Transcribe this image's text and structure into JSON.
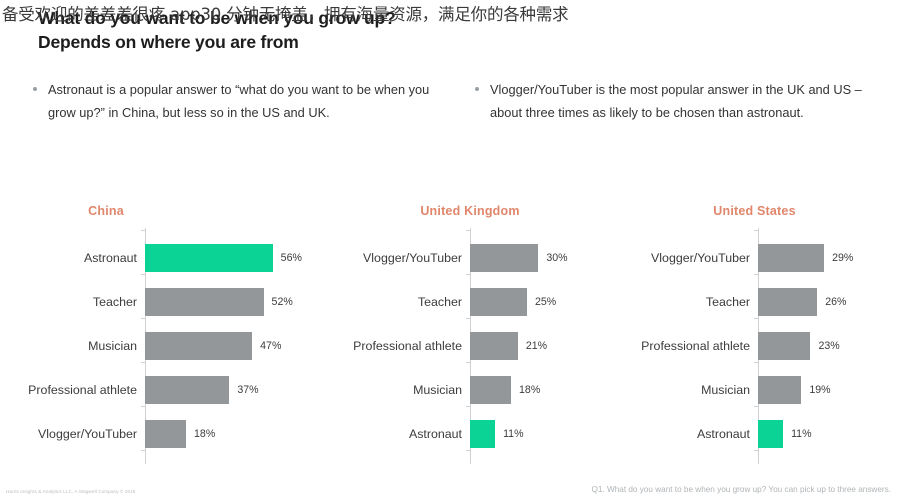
{
  "overlay": {
    "text": "备受欢迎的差差差很疼 app30 分钟无掩盖，拥有海量资源，满足你的各种需求"
  },
  "slide": {
    "title": "What do you want to be when you grow up? Depends on where you are from",
    "bullets": [
      "Astronaut is a popular answer to “what do you want to be when you grow up?” in China, but less so in the US and UK.",
      "Vlogger/YouTuber is the most popular answer in the UK and US – about three times as likely to be chosen than astronaut."
    ],
    "footer_left": "Harris Insights & Analytics LLC, A Stagwell Company © 2018",
    "footer_right": "Q1. What do you want to be when you grow up? You can pick up to three answers.",
    "colors": {
      "highlight": "#0bd395",
      "bar": "#949799",
      "panel_title": "#e0866b"
    }
  },
  "chart_data": [
    {
      "type": "bar",
      "title": "China",
      "orientation": "horizontal",
      "categories": [
        "Astronaut",
        "Teacher",
        "Musician",
        "Professional athlete",
        "Vlogger/YouTuber"
      ],
      "values": [
        56,
        52,
        47,
        37,
        18
      ],
      "labels": [
        "56%",
        "52%",
        "47%",
        "37%",
        "18%"
      ],
      "highlight_index": 0,
      "xlabel": "",
      "ylabel": "",
      "xlim": [
        0,
        60
      ],
      "grid": false,
      "legend": "none"
    },
    {
      "type": "bar",
      "title": "United Kingdom",
      "orientation": "horizontal",
      "categories": [
        "Vlogger/YouTuber",
        "Teacher",
        "Professional athlete",
        "Musician",
        "Astronaut"
      ],
      "values": [
        30,
        25,
        21,
        18,
        11
      ],
      "labels": [
        "30%",
        "25%",
        "21%",
        "18%",
        "11%"
      ],
      "highlight_index": 4,
      "xlabel": "",
      "ylabel": "",
      "xlim": [
        0,
        60
      ],
      "grid": false,
      "legend": "none"
    },
    {
      "type": "bar",
      "title": "United States",
      "orientation": "horizontal",
      "categories": [
        "Vlogger/YouTuber",
        "Teacher",
        "Professional athlete",
        "Musician",
        "Astronaut"
      ],
      "values": [
        29,
        26,
        23,
        19,
        11
      ],
      "labels": [
        "29%",
        "26%",
        "23%",
        "19%",
        "11%"
      ],
      "highlight_index": 4,
      "xlabel": "",
      "ylabel": "",
      "xlim": [
        0,
        60
      ],
      "grid": false,
      "legend": "none"
    }
  ]
}
